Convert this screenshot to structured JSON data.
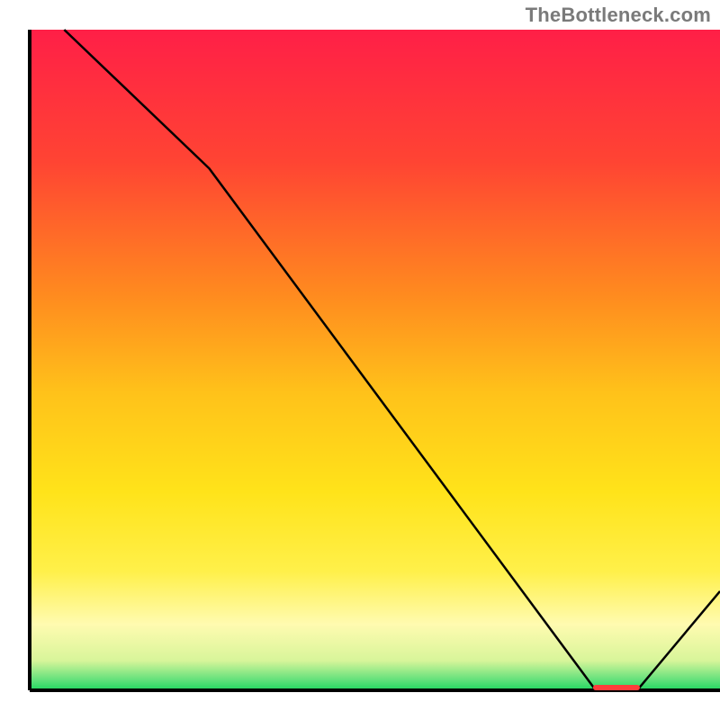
{
  "attribution": "TheBottleneck.com",
  "chart_data": {
    "type": "line",
    "title": "",
    "xlabel": "",
    "ylabel": "",
    "xlim": [
      0,
      100
    ],
    "ylim": [
      0,
      100
    ],
    "series": [
      {
        "name": "curve",
        "x": [
          5,
          26,
          82,
          88,
          100
        ],
        "values": [
          100,
          79,
          0,
          0,
          15
        ]
      }
    ],
    "marker_segment": {
      "x_start": 82,
      "x_end": 88,
      "y": 0,
      "color": "#ff3b3b"
    },
    "background_gradient": {
      "stops": [
        {
          "offset": 0.0,
          "color": "#ff1f47"
        },
        {
          "offset": 0.2,
          "color": "#ff4433"
        },
        {
          "offset": 0.4,
          "color": "#ff8a1f"
        },
        {
          "offset": 0.55,
          "color": "#ffc21a"
        },
        {
          "offset": 0.7,
          "color": "#ffe31a"
        },
        {
          "offset": 0.82,
          "color": "#fff04a"
        },
        {
          "offset": 0.9,
          "color": "#fffbb0"
        },
        {
          "offset": 0.955,
          "color": "#d8f59a"
        },
        {
          "offset": 0.985,
          "color": "#5fe07a"
        },
        {
          "offset": 1.0,
          "color": "#1fd65f"
        }
      ]
    },
    "axis_color": "#000000",
    "line_color": "#000000",
    "line_width": 2.5
  }
}
